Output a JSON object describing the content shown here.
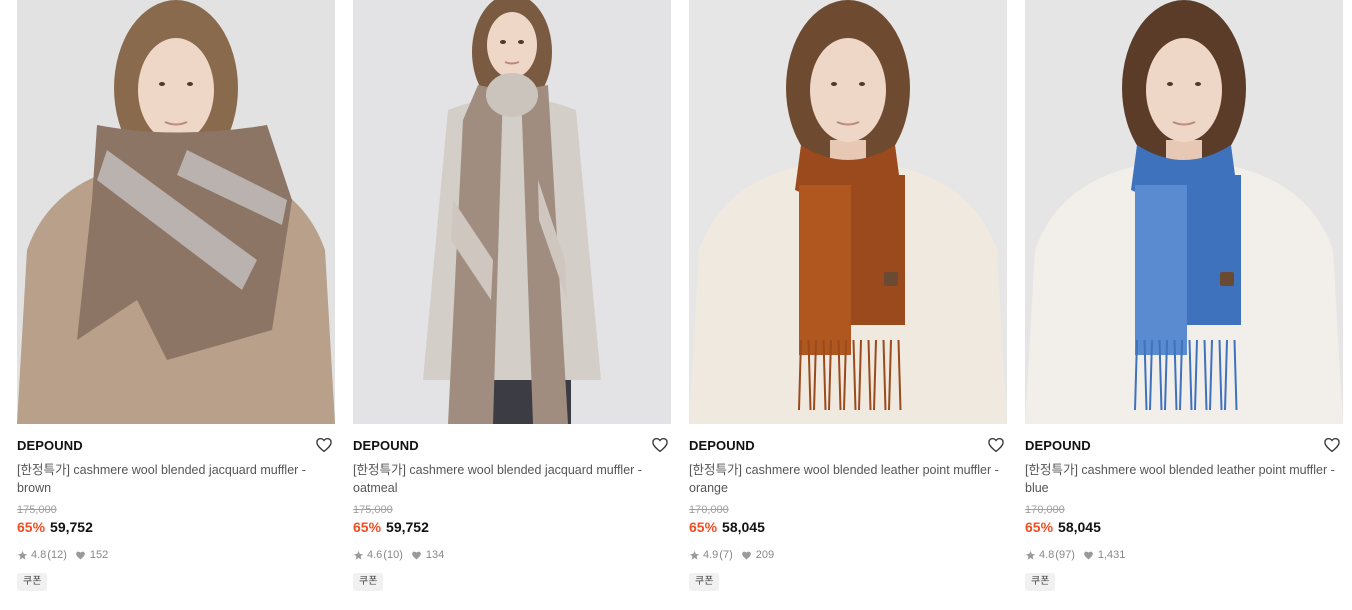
{
  "products": [
    {
      "brand": "DEPOUND",
      "title": "[한정특가] cashmere wool blended jacquard muffler - brown",
      "original_price": "175,000",
      "discount": "65%",
      "price": "59,752",
      "rating": "4.8",
      "reviews": "(12)",
      "likes": "152",
      "badge": "쿠폰",
      "colors": {
        "bg": "#e2e2e3",
        "garment": "#b8a08a",
        "scarf": "#8c7564",
        "scarf_alt": "#b9b2ae",
        "hair": "#8a6a4c"
      }
    },
    {
      "brand": "DEPOUND",
      "title": "[한정특가] cashmere wool blended jacquard muffler - oatmeal",
      "original_price": "175,000",
      "discount": "65%",
      "price": "59,752",
      "rating": "4.6",
      "reviews": "(10)",
      "likes": "134",
      "badge": "쿠폰",
      "colors": {
        "bg": "#e3e3e5",
        "garment": "#d3cec8",
        "scarf": "#a08d80",
        "scarf_alt": "#cfc6c0",
        "hair": "#7a5a40"
      }
    },
    {
      "brand": "DEPOUND",
      "title": "[한정특가] cashmere wool blended leather point muffler - orange",
      "original_price": "170,000",
      "discount": "65%",
      "price": "58,045",
      "rating": "4.9",
      "reviews": "(7)",
      "likes": "209",
      "badge": "쿠폰",
      "colors": {
        "bg": "#e6e6e7",
        "garment": "#efe9e0",
        "scarf": "#9a4a1c",
        "scarf_alt": "#b0571f",
        "hair": "#6e4a30"
      }
    },
    {
      "brand": "DEPOUND",
      "title": "[한정특가] cashmere wool blended leather point muffler - blue",
      "original_price": "170,000",
      "discount": "65%",
      "price": "58,045",
      "rating": "4.8",
      "reviews": "(97)",
      "likes": "1,431",
      "badge": "쿠폰",
      "colors": {
        "bg": "#e5e5e6",
        "garment": "#f2efea",
        "scarf": "#3f72bd",
        "scarf_alt": "#5a8bd0",
        "hair": "#5a3c28"
      }
    }
  ],
  "icons": {
    "wishlist": "heart-outline-icon",
    "rating": "star-icon",
    "likes": "heart-filled-icon"
  },
  "accent": {
    "discount": "#f04e23"
  }
}
